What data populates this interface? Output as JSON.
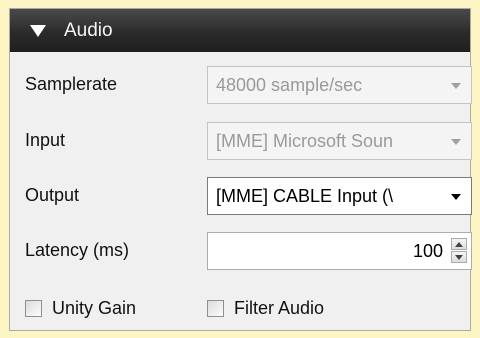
{
  "header": {
    "title": "Audio"
  },
  "samplerate": {
    "label": "Samplerate",
    "value": "48000 sample/sec"
  },
  "input": {
    "label": "Input",
    "value": "[MME] Microsoft Soun"
  },
  "output": {
    "label": "Output",
    "value": "[MME] CABLE Input (\\"
  },
  "latency": {
    "label": "Latency (ms)",
    "value": "100"
  },
  "unity_gain": {
    "label": "Unity Gain",
    "checked": false
  },
  "filter_audio": {
    "label": "Filter Audio",
    "checked": false
  },
  "colors": {
    "background": "#fdf6c4",
    "panel": "#f0f0f0",
    "header": "#2b2b2b"
  },
  "icons": [
    "collapse-triangle-icon",
    "chevron-down-icon",
    "spin-up-icon",
    "spin-down-icon"
  ]
}
